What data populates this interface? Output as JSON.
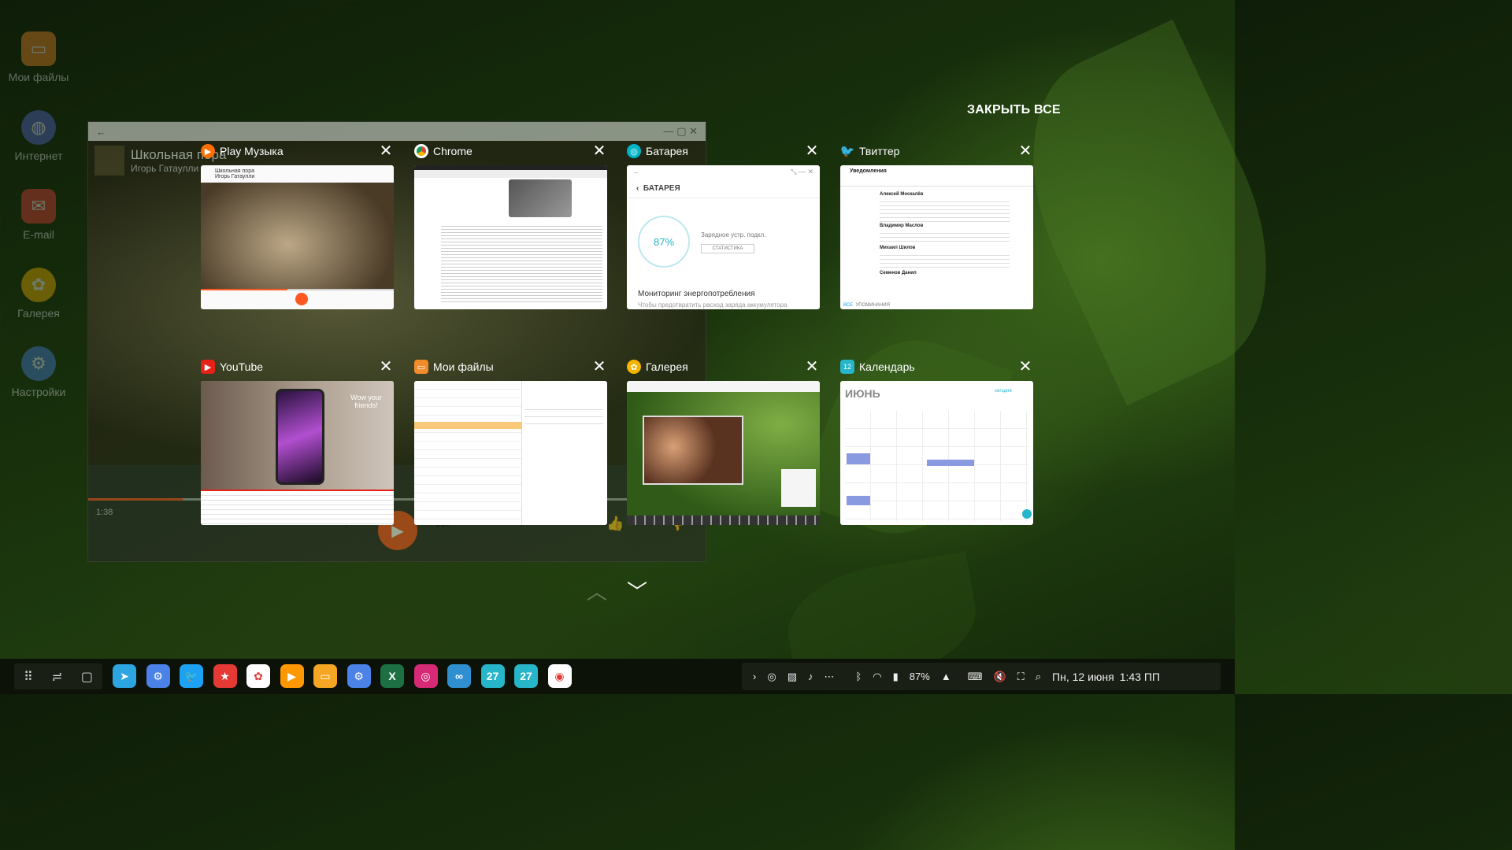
{
  "desktop": {
    "icons": [
      {
        "label": "Мои файлы",
        "icon": "folder-icon",
        "color": "#f28b2a"
      },
      {
        "label": "Интернет",
        "icon": "globe-icon",
        "color": "#5a6ad6"
      },
      {
        "label": "E-mail",
        "icon": "mail-icon",
        "color": "#e8403a"
      },
      {
        "label": "Галерея",
        "icon": "flower-icon",
        "color": "#f4b400"
      },
      {
        "label": "Настройки",
        "icon": "gear-icon",
        "color": "#4a82e8"
      }
    ]
  },
  "background_window": {
    "song_title": "Школьная пора",
    "artist": "Игорь Гатаулли",
    "time": "1:38"
  },
  "recents": {
    "close_all": "ЗАКРЫТЬ ВСЕ",
    "cards": [
      {
        "title": "Play Музыка",
        "icon": "play-music-icon",
        "color": "#ff6f00"
      },
      {
        "title": "Chrome",
        "icon": "chrome-icon",
        "color": "#4285f4"
      },
      {
        "title": "Батарея",
        "icon": "battery-icon",
        "color": "#00b4c8"
      },
      {
        "title": "Твиттер",
        "icon": "twitter-icon",
        "color": "#1da1f2"
      },
      {
        "title": "YouTube",
        "icon": "youtube-icon",
        "color": "#e62117"
      },
      {
        "title": "Мои файлы",
        "icon": "folder-icon",
        "color": "#f28b2a"
      },
      {
        "title": "Галерея",
        "icon": "flower-icon",
        "color": "#f4b400"
      },
      {
        "title": "Календарь",
        "icon": "calendar-icon",
        "color": "#26b5c9"
      }
    ],
    "previews": {
      "music": {
        "title": "Школьная пора",
        "artist": "Игорь Гатаулли"
      },
      "battery": {
        "heading": "БАТАРЕЯ",
        "percent": "87%",
        "status": "Зарядное устр. подкл.",
        "stats": "СТАТИСТИКА",
        "monitor": "Мониторинг энергопотребления",
        "monitor_sub": "Чтобы предотвратить расход заряда аккумулятора"
      },
      "twitter": {
        "heading": "Уведомления",
        "name1": "Алексей Москалёв",
        "name2": "Владимир Маслов",
        "name3": "Михаил Шилов",
        "name4": "Семенов Данил",
        "tab_all": "ВСЕ",
        "tab_mentions": "УПОМИНАНИЯ"
      },
      "youtube": {
        "overlay": "Wow your friends!"
      },
      "calendar": {
        "month": "ИЮНЬ",
        "today": "сегодня"
      }
    }
  },
  "taskbar": {
    "apps": [
      {
        "icon": "telegram-icon",
        "color": "#2ca5e0",
        "glyph": "➤"
      },
      {
        "icon": "settings-icon",
        "color": "#4a82e8",
        "glyph": "⚙"
      },
      {
        "icon": "twitter-icon",
        "color": "#1da1f2",
        "glyph": "🐦"
      },
      {
        "icon": "bookmark-icon",
        "color": "#e53935",
        "glyph": "★"
      },
      {
        "icon": "photos-icon",
        "color": "#ffffff",
        "glyph": "✿"
      },
      {
        "icon": "play-music-icon",
        "color": "#ff9800",
        "glyph": "▶"
      },
      {
        "icon": "folder-icon",
        "color": "#f5a623",
        "glyph": "▭"
      },
      {
        "icon": "settings-icon",
        "color": "#4a82e8",
        "glyph": "⚙"
      },
      {
        "icon": "excel-icon",
        "color": "#1d7044",
        "glyph": "X"
      },
      {
        "icon": "instagram-icon",
        "color": "#d62976",
        "glyph": "◎"
      },
      {
        "icon": "sync-icon",
        "color": "#2f8fd0",
        "glyph": "∞"
      },
      {
        "icon": "calendar-icon",
        "color": "#26b5c9",
        "glyph": "27"
      },
      {
        "icon": "calendar-icon",
        "color": "#26b5c9",
        "glyph": "27"
      },
      {
        "icon": "chrome-icon",
        "color": "#ffffff",
        "glyph": "◉"
      }
    ],
    "battery": "87%",
    "date": "Пн, 12 июня",
    "time": "1:43 ПП"
  }
}
